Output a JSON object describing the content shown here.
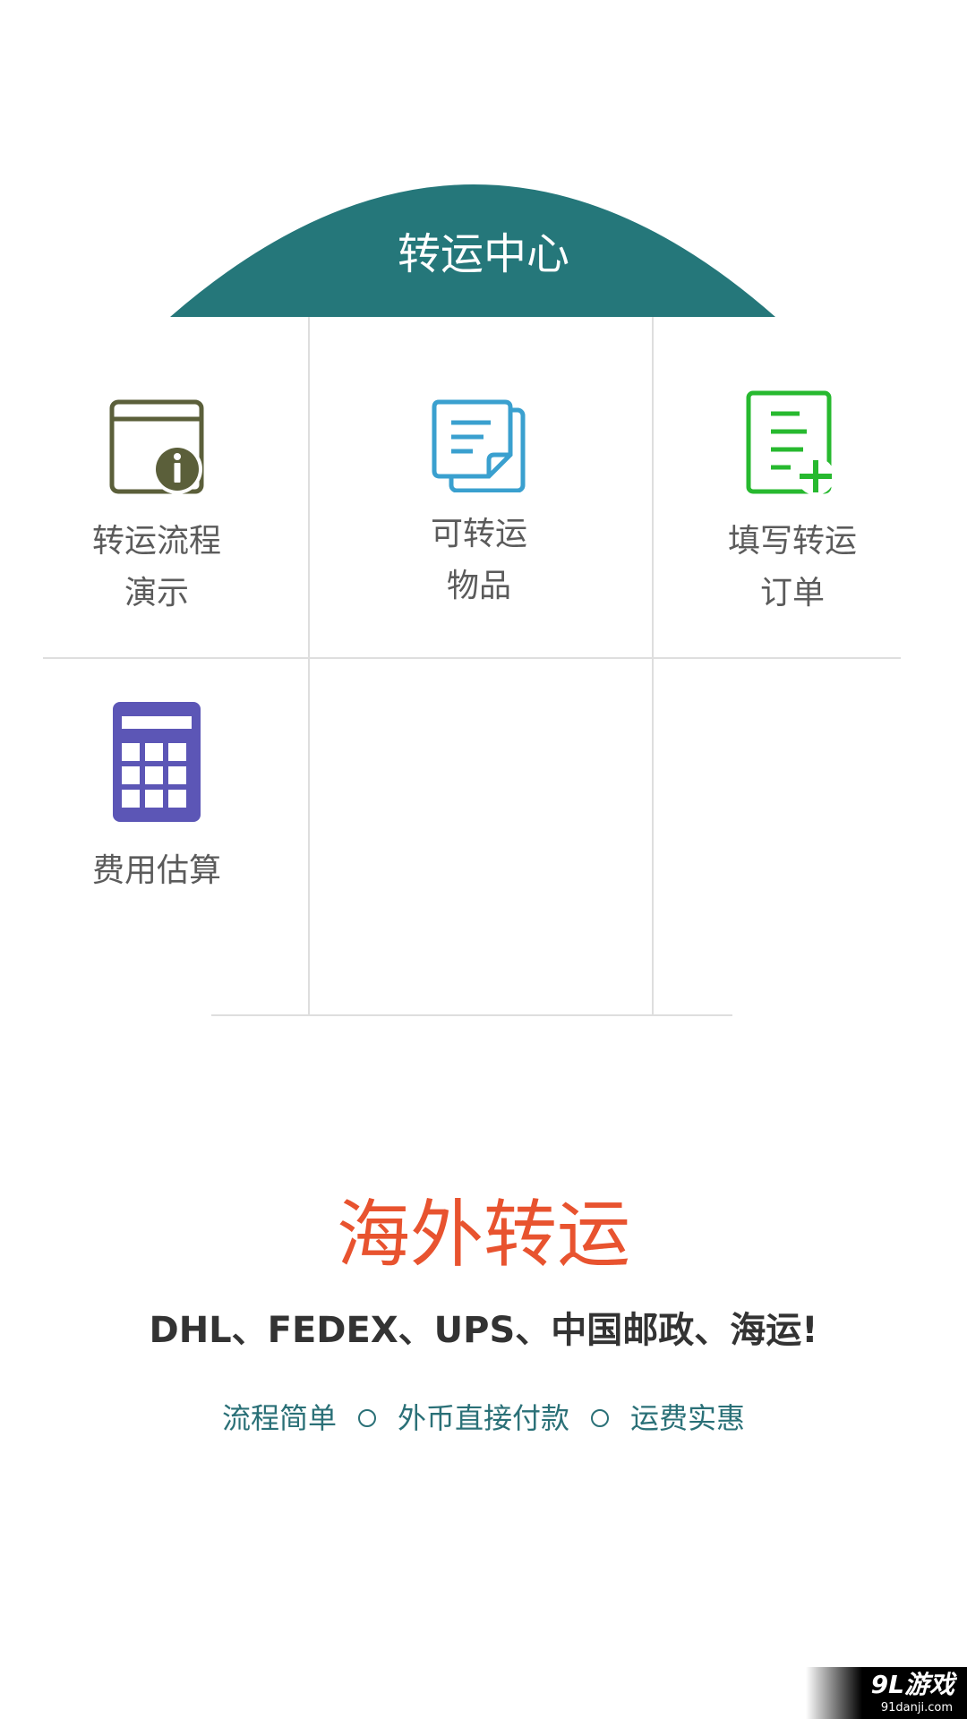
{
  "header": {
    "title": "转运中心",
    "color": "#25777a"
  },
  "tiles": [
    {
      "id": "process-demo",
      "line1": "转运流程",
      "line2": "演示",
      "icon": "info-window-icon",
      "icon_color": "#5b5f3a"
    },
    {
      "id": "shippable-items",
      "line1": "可转运",
      "line2": "物品",
      "icon": "documents-icon",
      "icon_color": "#3aa0cf"
    },
    {
      "id": "fill-order",
      "line1": "填写转运",
      "line2": "订单",
      "icon": "add-document-icon",
      "icon_color": "#27b92f"
    },
    {
      "id": "cost-estimate",
      "line1": "费用估算",
      "line2": "",
      "icon": "calculator-icon",
      "icon_color": "#5c56b6"
    }
  ],
  "promo": {
    "title": "海外转运",
    "carriers": "DHL、FEDEX、UPS、中国邮政、海运!",
    "features": [
      "流程简单",
      "外币直接付款",
      "运费实惠"
    ],
    "title_color": "#e8532f",
    "feature_color": "#2a7077"
  },
  "watermark": {
    "main": "9L游戏",
    "sub": "91danji.com"
  }
}
